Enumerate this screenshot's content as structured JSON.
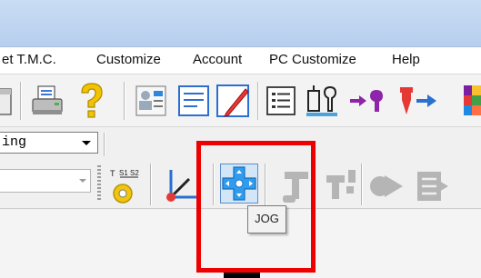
{
  "menu": {
    "items": [
      "et T.M.C.",
      "Customize",
      "Account",
      "PC Customize",
      "Help"
    ]
  },
  "toolbar1": {
    "icons": [
      "open-icon",
      "print-icon",
      "help-icon",
      "card-icon",
      "edit-icon",
      "list-icon",
      "tool-setup-icon",
      "tool-transfer-icon",
      "tool-offset-icon",
      "color-grid-icon"
    ]
  },
  "mode_select": {
    "value": "ing"
  },
  "toolbar3": {
    "icons": [
      "tool-offset-measure-icon",
      "coordinate-axis-icon",
      "jog-icon",
      "tool-change-icon",
      "tool-change-2-icon",
      "arrow-icon",
      "program-icon"
    ]
  },
  "tooltip": {
    "text": "JOG"
  },
  "colors": {
    "highlight": "#ee0000",
    "title_bar": "#c9dcf3",
    "jog_selected": "#d3e6f8"
  }
}
